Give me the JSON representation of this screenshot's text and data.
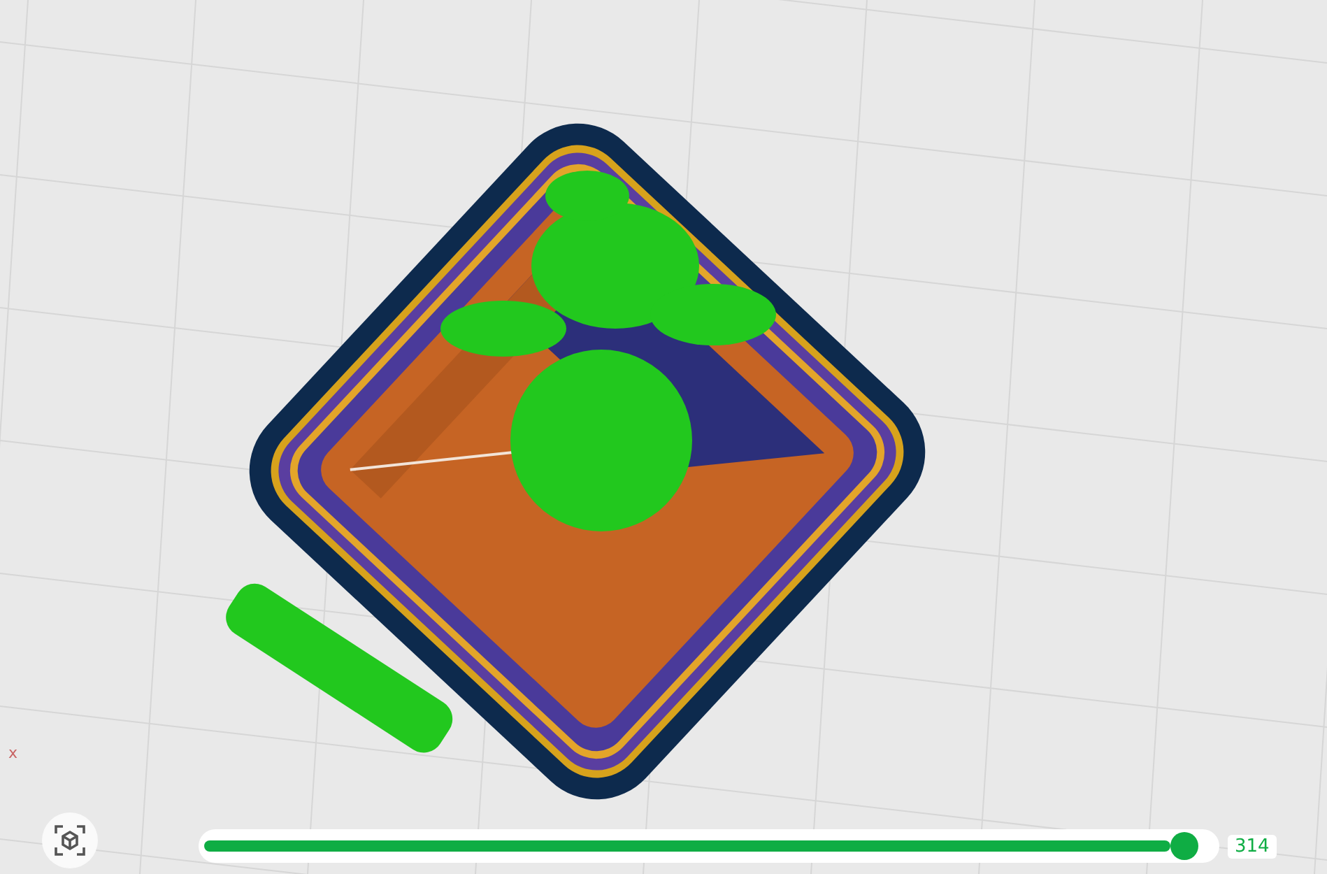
{
  "viewport": {
    "axis_label": "x"
  },
  "view_button": {
    "kind": "view-cube"
  },
  "layer_slider": {
    "level": 0.985,
    "reading": "314"
  }
}
